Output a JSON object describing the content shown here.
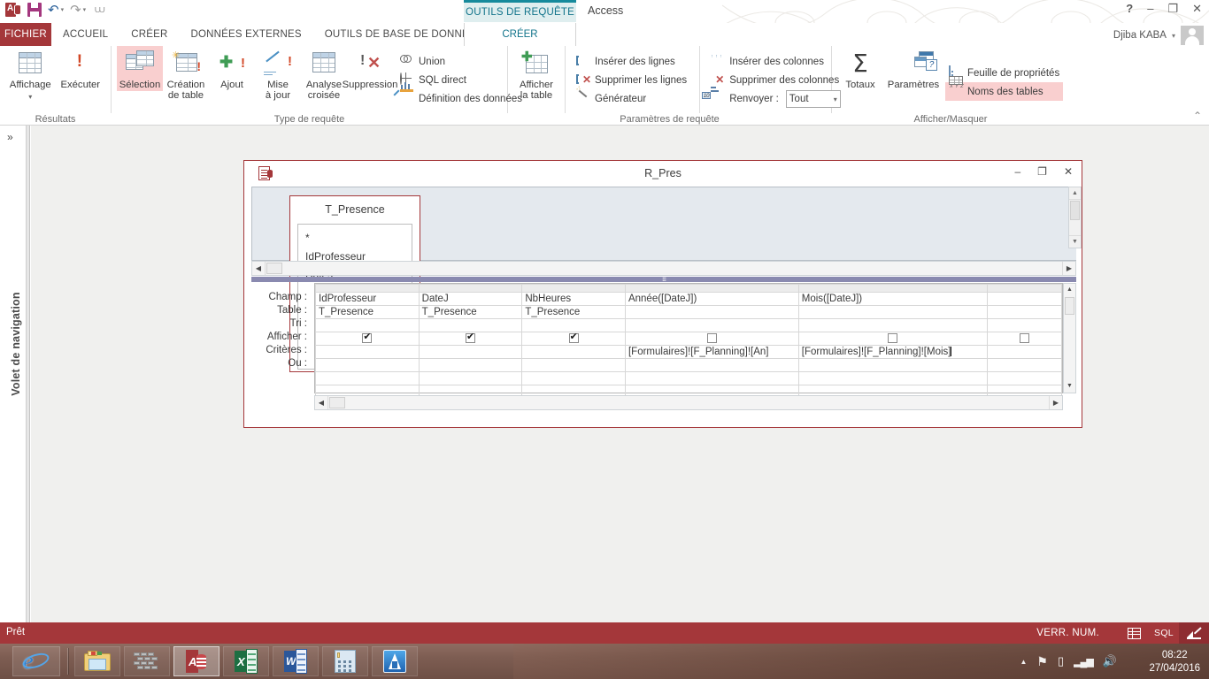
{
  "titlebar": {
    "app_name": "Access",
    "contextual_tab": "OUTILS DE REQUÊTE",
    "quick_access": [
      {
        "name": "access-logo",
        "label": "Access"
      },
      {
        "name": "save-icon",
        "label": "Enregistrer"
      },
      {
        "name": "undo-icon",
        "label": "Annuler"
      },
      {
        "name": "redo-icon",
        "label": "Rétablir"
      },
      {
        "name": "customize-qat-icon",
        "label": "Personnaliser"
      }
    ],
    "help_glyph": "?",
    "minimize_glyph": "–",
    "restore_glyph": "❐",
    "close_glyph": "✕",
    "user_name": "Djiba KABA",
    "user_caret": "▾"
  },
  "tabs": {
    "file": "FICHIER",
    "items": [
      {
        "label": "ACCUEIL",
        "active": false
      },
      {
        "label": "CRÉER",
        "active": false
      },
      {
        "label": "DONNÉES EXTERNES",
        "active": false
      },
      {
        "label": "OUTILS DE BASE DE DONNÉES",
        "active": false
      }
    ],
    "contextual_active": "CRÉER"
  },
  "ribbon": {
    "collapse_glyph": "⌃",
    "groups": [
      {
        "name": "resultats",
        "label": "Résultats",
        "big_buttons": [
          {
            "label": "Affichage",
            "icon": "table-view-icon",
            "dropdown": true,
            "highlighted": false
          },
          {
            "label": "Exécuter",
            "icon": "run-exclamation-icon",
            "dropdown": false,
            "highlighted": false
          }
        ]
      },
      {
        "name": "type-de-requete",
        "label": "Type de requête",
        "big_buttons": [
          {
            "label": "Sélection",
            "icon": "select-query-icon",
            "dropdown": false,
            "highlighted": true
          },
          {
            "label": "Création\nde table",
            "line1": "Création",
            "line2": "de table",
            "icon": "make-table-query-icon",
            "highlighted": false
          },
          {
            "label": "Ajout",
            "icon": "append-query-icon",
            "highlighted": false
          },
          {
            "label": "Mise\nà jour",
            "line1": "Mise",
            "line2": "à jour",
            "icon": "update-query-icon",
            "highlighted": false
          },
          {
            "label": "Analyse\ncroisée",
            "line1": "Analyse",
            "line2": "croisée",
            "icon": "crosstab-query-icon",
            "highlighted": false
          },
          {
            "label": "Suppression",
            "icon": "delete-query-icon",
            "highlighted": false
          }
        ],
        "small_buttons": [
          {
            "label": "Union",
            "icon": "union-icon"
          },
          {
            "label": "SQL direct",
            "icon": "globe-icon"
          },
          {
            "label": "Définition des données",
            "icon": "data-definition-icon"
          }
        ]
      },
      {
        "name": "parametres-de-requete",
        "label": "Paramètres de requête",
        "big_buttons": [
          {
            "label": "Afficher\nla table",
            "line1": "Afficher",
            "line2": "la table",
            "icon": "show-table-icon",
            "highlighted": false
          }
        ],
        "small_col_a": [
          {
            "label": "Insérer des lignes",
            "icon": "insert-rows-icon"
          },
          {
            "label": "Supprimer les lignes",
            "icon": "delete-rows-icon"
          },
          {
            "label": "Générateur",
            "icon": "builder-wand-icon"
          }
        ],
        "small_col_b": [
          {
            "label": "Insérer des colonnes",
            "icon": "insert-columns-icon"
          },
          {
            "label": "Supprimer des colonnes",
            "icon": "delete-columns-icon"
          }
        ],
        "return_label": "Renvoyer :",
        "return_value": "Tout",
        "return_caret": "▾"
      },
      {
        "name": "afficher-masquer",
        "label": "Afficher/Masquer",
        "big_buttons": [
          {
            "label": "Totaux",
            "icon": "sigma-totals-icon",
            "highlighted": false
          },
          {
            "label": "Paramètres",
            "icon": "parameters-icon",
            "highlighted": false
          }
        ],
        "small_buttons": [
          {
            "label": "Feuille de propriétés",
            "icon": "property-sheet-icon",
            "highlighted": false
          },
          {
            "label": "Noms des tables",
            "icon": "table-names-icon",
            "highlighted": true
          }
        ]
      }
    ],
    "accent_highlight": "#f9cfcf"
  },
  "navigation_pane": {
    "label": "Volet de navigation",
    "expand_glyph": "»"
  },
  "query_window": {
    "title": "R_Pres",
    "icon": "query-design-icon",
    "minimize_glyph": "–",
    "restore_glyph": "❐",
    "close_glyph": "✕",
    "table": {
      "name": "T_Presence",
      "fields": [
        "*",
        "IdProfesseur",
        "DateJ"
      ]
    },
    "scroll": {
      "up": "▲",
      "down": "▼",
      "left": "◀",
      "right": "▶",
      "grip": "⁞⁞⁞⁞"
    },
    "grid": {
      "row_labels": [
        "Champ :",
        "Table :",
        "Tri :",
        "Afficher :",
        "Critères :",
        "Ou :"
      ],
      "columns": [
        {
          "champ": "IdProfesseur",
          "table": "T_Presence",
          "tri": "",
          "afficher": true,
          "criteres": "",
          "ou": ""
        },
        {
          "champ": "DateJ",
          "table": "T_Presence",
          "tri": "",
          "afficher": true,
          "criteres": "",
          "ou": ""
        },
        {
          "champ": "NbHeures",
          "table": "T_Presence",
          "tri": "",
          "afficher": true,
          "criteres": "",
          "ou": ""
        },
        {
          "champ": "Année([DateJ])",
          "table": "",
          "tri": "",
          "afficher": false,
          "criteres": "[Formulaires]![F_Planning]![An]",
          "ou": ""
        },
        {
          "champ": "Mois([DateJ])",
          "table": "",
          "tri": "",
          "afficher": false,
          "criteres": "[Formulaires]![F_Planning]![Mois]",
          "criteres_has_caret": true,
          "ou": ""
        },
        {
          "champ": "",
          "table": "",
          "tri": "",
          "afficher": false,
          "criteres": "",
          "ou": ""
        }
      ],
      "checkbox_check": "✔"
    }
  },
  "status_bar": {
    "left_text": "Prêt",
    "num_lock": "VERR. NUM.",
    "view_buttons": [
      {
        "name": "datasheet-view-icon",
        "label": "Feuille de données",
        "active": false
      },
      {
        "name": "sql-view-label",
        "label": "SQL",
        "active": false
      },
      {
        "name": "design-view-icon",
        "label": "Mode Création",
        "active": true
      }
    ],
    "background": "#a4373a"
  },
  "taskbar": {
    "start_icon": "internet-explorer-icon",
    "items": [
      {
        "name": "file-explorer-icon",
        "label": "Explorateur",
        "active": false
      },
      {
        "name": "firewall-bricks-icon",
        "label": "Pare-feu",
        "active": false
      },
      {
        "name": "access-taskbar-icon",
        "label": "Access",
        "active": true
      },
      {
        "name": "excel-taskbar-icon",
        "label": "Excel",
        "active": false
      },
      {
        "name": "word-taskbar-icon",
        "label": "Word",
        "active": false
      },
      {
        "name": "calculator-icon",
        "label": "Calculatrice",
        "active": false
      },
      {
        "name": "blue-app-icon",
        "label": "Application",
        "active": false
      }
    ],
    "tray": [
      {
        "name": "show-hidden-icons-icon",
        "glyph": "▲"
      },
      {
        "name": "action-center-flag-icon",
        "glyph": "⚑"
      },
      {
        "name": "removable-media-icon",
        "glyph": "▯"
      },
      {
        "name": "network-signal-icon",
        "glyph": "▂▄▆"
      },
      {
        "name": "volume-icon",
        "glyph": "🔊"
      }
    ],
    "clock_time": "08:22",
    "clock_date": "27/04/2016"
  }
}
